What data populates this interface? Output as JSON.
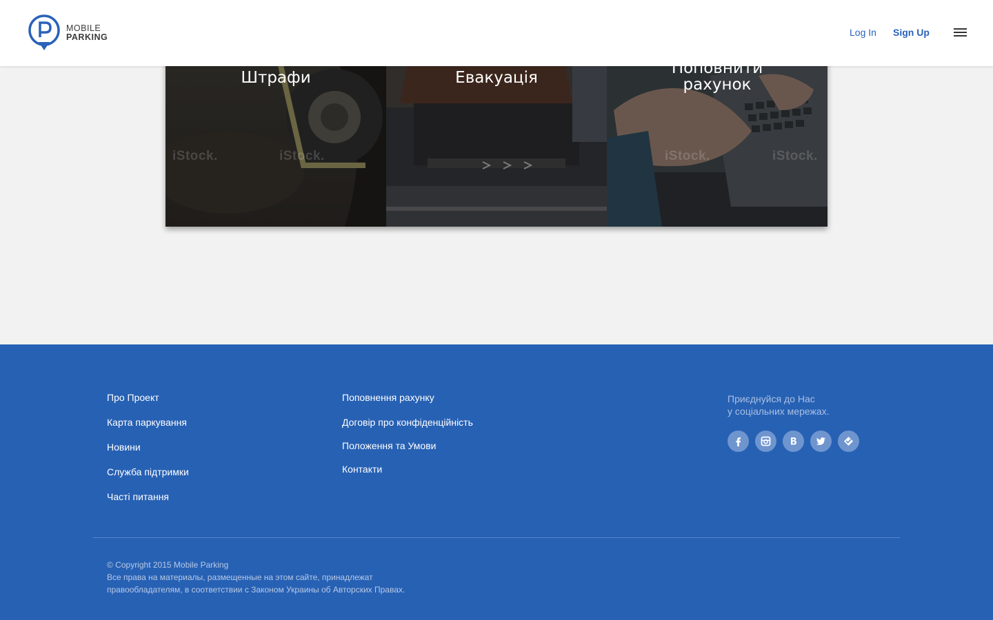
{
  "header": {
    "logo_line1": "MOBILE",
    "logo_line2": "PARKING",
    "login_label": "Log In",
    "signup_label": "Sign Up",
    "menu_icon": "hamburger-menu-icon"
  },
  "tiles": [
    {
      "title": "Штрафи",
      "watermark": "iStock."
    },
    {
      "title": "Евакуація",
      "watermark": ""
    },
    {
      "title_line1": "Поповнити",
      "title_line2": "рахунок",
      "watermark": "iStock."
    }
  ],
  "footer": {
    "col1": [
      "Про Проект",
      "Карта паркування",
      "Новини",
      "Служба підтримки",
      "Часті питання"
    ],
    "col2": [
      "Поповнення рахунку",
      "Договір про конфіденційність",
      "Положення та Умови",
      "Контакти"
    ],
    "join_line1": "Приєднуйся до Нас",
    "join_line2": "у соціальних мережах.",
    "social_icons": [
      "facebook-icon",
      "instagram-icon",
      "vk-icon",
      "twitter-icon",
      "foursquare-icon"
    ],
    "copyright_line1": "© Copyright 2015 Mobile Parking",
    "copyright_line2": "Все права на материалы, размещенные на этом сайте, принадлежат",
    "copyright_line3": "правообладателям, в соответствии с Законом Украины об Авторских Правах."
  },
  "colors": {
    "brand_blue": "#2761b4",
    "link_blue": "#2a62b8",
    "social_bg": "#6f95cf"
  }
}
